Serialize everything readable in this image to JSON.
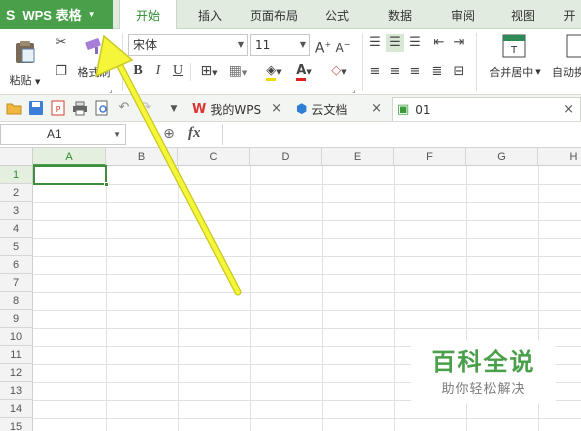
{
  "app": {
    "name": "WPS 表格"
  },
  "tabs": [
    {
      "label": "开始",
      "active": true
    },
    {
      "label": "插入"
    },
    {
      "label": "页面布局"
    },
    {
      "label": "公式"
    },
    {
      "label": "数据"
    },
    {
      "label": "审阅"
    },
    {
      "label": "视图"
    },
    {
      "label": "开"
    }
  ],
  "ribbon": {
    "paste_label": "粘贴",
    "format_painter_label": "格式刷",
    "font_name": "宋体",
    "font_size": "11",
    "merge_label": "合并居中",
    "wrap_label": "自动换"
  },
  "doc_tabs": [
    {
      "label": "我的WPS",
      "icon": "wps-logo-icon"
    },
    {
      "label": "云文档",
      "icon": "cloud-doc-icon"
    },
    {
      "label": "01",
      "icon": "spreadsheet-icon",
      "active": true
    }
  ],
  "formula_bar": {
    "name_box": "A1",
    "fx_label": "fx",
    "content": ""
  },
  "grid": {
    "columns": [
      "A",
      "B",
      "C",
      "D",
      "E",
      "F",
      "G",
      "H"
    ],
    "rows": [
      "1",
      "2",
      "3",
      "4",
      "5",
      "6",
      "7",
      "8",
      "9",
      "10",
      "11",
      "12",
      "13",
      "14",
      "15"
    ],
    "active_cell": "A1"
  },
  "watermark": {
    "title": "百科全说",
    "subtitle": "助你轻松解决"
  },
  "colors": {
    "accent": "#4aa04a",
    "arrow": "#f5f53a"
  }
}
